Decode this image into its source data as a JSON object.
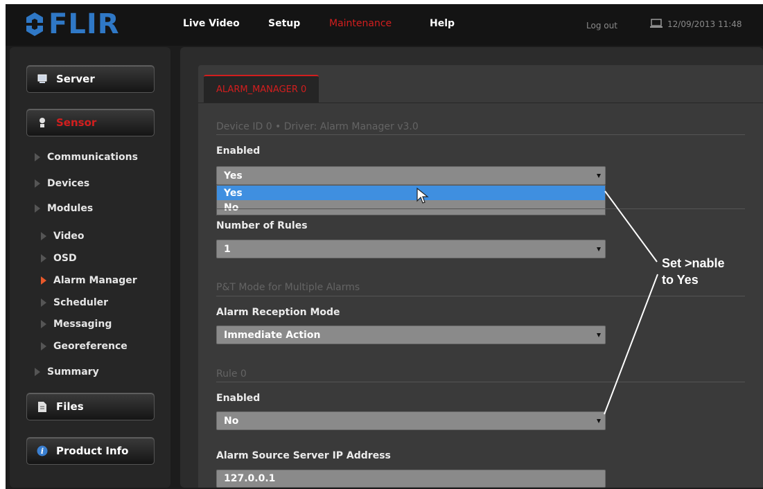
{
  "header": {
    "logo_text": "FLIR",
    "nav": [
      "Live Video",
      "Setup",
      "Maintenance",
      "Help"
    ],
    "active_nav": "Maintenance",
    "logout_label": "Log out",
    "datetime": "12/09/2013 11:48"
  },
  "sidebar": {
    "buttons": {
      "server": "Server",
      "sensor": "Sensor",
      "files": "Files",
      "product_info": "Product Info"
    },
    "tree": {
      "communications": "Communications",
      "devices": "Devices",
      "modules": "Modules",
      "video": "Video",
      "osd": "OSD",
      "alarm_manager": "Alarm Manager",
      "scheduler": "Scheduler",
      "messaging": "Messaging",
      "georeference": "Georeference",
      "summary": "Summary"
    }
  },
  "main": {
    "tab_label": "ALARM_MANAGER 0",
    "device_header": "Device ID 0  •  Driver: Alarm Manager v3.0",
    "enabled_label": "Enabled",
    "enabled_value": "Yes",
    "enabled_options": [
      "Yes",
      "No"
    ],
    "highlighted_option": "Yes",
    "rules_label": "Number of Rules",
    "rules_value": "1",
    "pt_header": "P&T Mode for Multiple Alarms",
    "reception_label": "Alarm Reception Mode",
    "reception_value": "Immediate Action",
    "rule_header": "Rule 0",
    "rule_enabled_label": "Enabled",
    "rule_enabled_value": "No",
    "source_ip_label": "Alarm Source Server IP Address",
    "source_ip_value": "127.0.0.1"
  },
  "annotation": {
    "line1": "Set >nable",
    "line2": "to Yes"
  },
  "colors": {
    "accent_red": "#d31e1e",
    "logo_blue": "#2f78c6",
    "highlight_blue": "#3f8fe0"
  }
}
